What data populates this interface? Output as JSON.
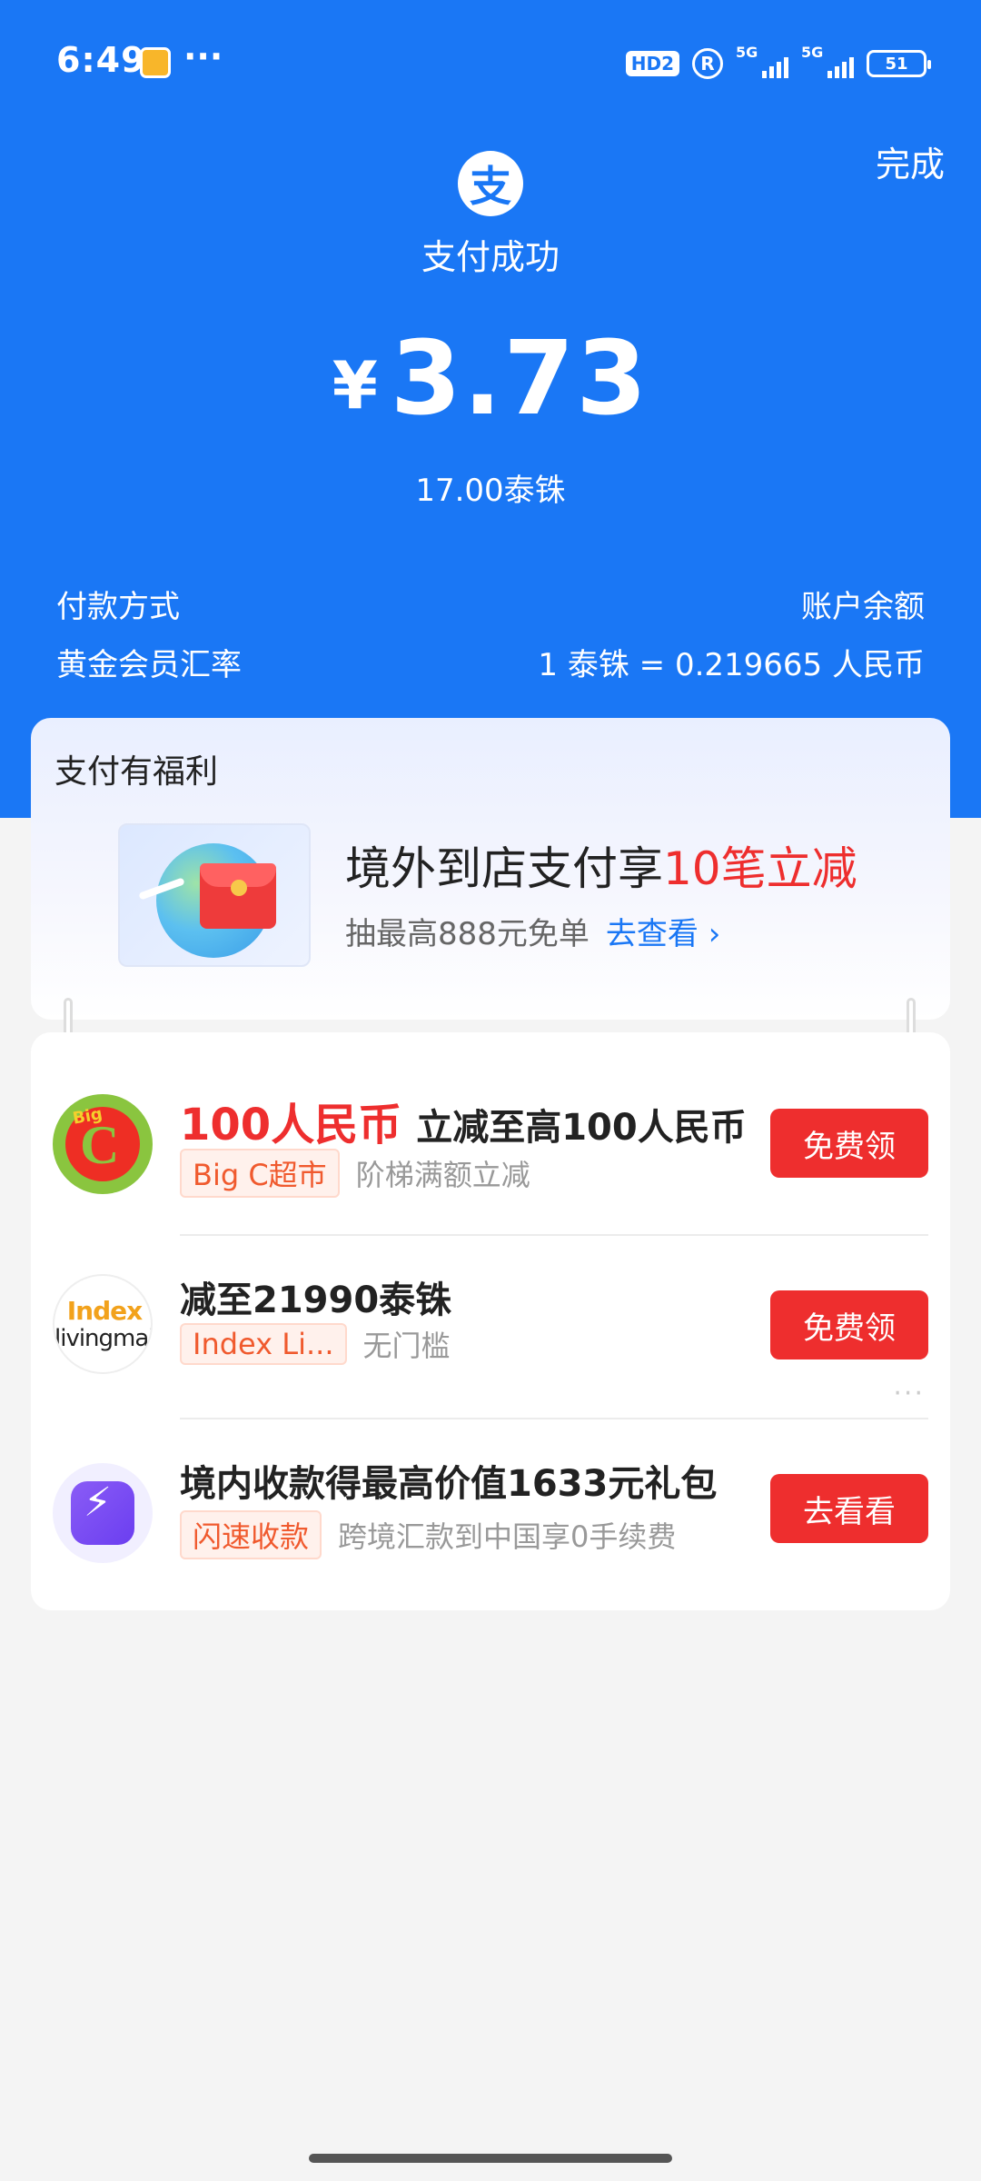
{
  "status_bar": {
    "time": "6:49",
    "dots": "···",
    "hd": "HD2",
    "r": "R",
    "signal1": "5G",
    "signal2": "5G",
    "battery": "51"
  },
  "header": {
    "done": "完成",
    "logo_char": "支",
    "status": "支付成功"
  },
  "amount": {
    "currency": "¥",
    "value": "3.73",
    "local": "17.00泰铢"
  },
  "info": {
    "pay_method_label": "付款方式",
    "pay_method_value": "账户余额",
    "rate_label": "黄金会员汇率",
    "rate_value": "1 泰铢 = 0.219665 人民币"
  },
  "promo": {
    "title": "支付有福利",
    "main_prefix": "境外到店支付享",
    "main_highlight": "10笔立减",
    "sub": "抽最高888元免单",
    "link": "去查看 ›"
  },
  "coupons": [
    {
      "amount": "100人民币",
      "title": "立减至高100人民币",
      "tag": "Big C超市",
      "desc": "阶梯满额立减",
      "cta": "免费领",
      "logo": {
        "big": "Big",
        "c": "C"
      }
    },
    {
      "title": "减至21990泰铢",
      "tag": "Index Li...",
      "desc": "无门槛",
      "cta": "免费领",
      "logo": {
        "t1": "Index",
        "t2": "livingmall"
      }
    },
    {
      "title": "境内收款得最高价值1633元礼包",
      "tag": "闪速收款",
      "desc": "跨境汇款到中国享0手续费",
      "cta": "去看看"
    }
  ],
  "colors": {
    "primary_blue": "#1a77f5",
    "accent_red": "#ee2e2e",
    "tag_orange": "#f05a2e"
  }
}
